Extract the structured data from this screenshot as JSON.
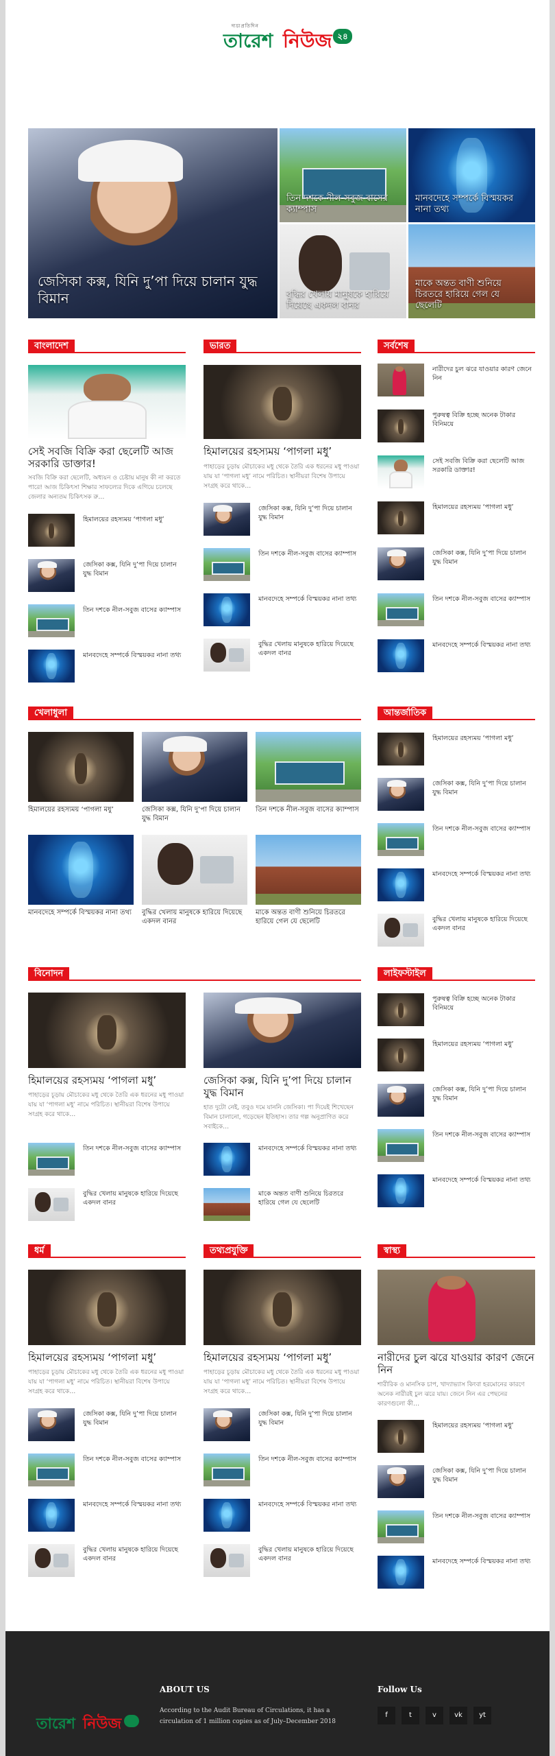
{
  "header": {
    "logo_tag": "দ্যচ্যপ্রতিদিন",
    "logo_word1": "তারেশ",
    "logo_word2": "নিউজ",
    "logo_badge": "২৪"
  },
  "hero": {
    "main": "জেসিকা কক্স, যিনি দু’পা দিয়ে চালান যুদ্ধ বিমান",
    "t1": "তিন দশকে নীল-সবুজ বাসের ক্যাম্পাস",
    "t2": "মানবদেহে সম্পর্কে বিস্ময়কর নানা তথ্য",
    "t3": "বুদ্ধির খেলায় মানুষকে হারিয়ে দিয়েছে একদল বানর",
    "t4": "মাকে অন্তত বাণী শুনিয়ে চিরতরে হারিয়ে গেল যে ছেলেটি"
  },
  "titles": {
    "cave": "হিমালয়ের রহস্যময় ‘পাগলা মধু’",
    "pilot": "জেসিকা কক্স, যিনি দু’পা দিয়ে চালান যুদ্ধ বিমান",
    "bus": "তিন দশকে নীল-সবুজ বাসের ক্যাম্পাস",
    "body": "মানবদেহে সম্পর্কে বিস্ময়কর নানা তথ্য",
    "chimp": "বুদ্ধির খেলায় মানুষকে হারিয়ে দিয়েছে একদল বানর",
    "ruin": "মাকে অন্তত বাণী শুনিয়ে চিরতরে হারিয়ে গেল যে ছেলেটি",
    "doctor": "সেই সবজি বিক্রি করা ছেলেটি আজ সরকারি ডাক্তার!",
    "woman": "নারীদের চুল ঝরে যাওয়ার কারণ জেনে নিন",
    "money": "পুরুষত্ব বিক্রি হচ্ছে অনেক টাকার বিনিময়ে"
  },
  "excerpts": {
    "doctor": "সবজি বিক্রি করা ছেলেটি, অধ্যয়ন ও চেষ্টায় মানুষ কী না করতে পারে! আজ চিকিৎসা শিক্ষার সাফল্যের দিকে এগিয়ে চলেছে জেলার অন্যতম চিকিৎসক রু…",
    "cave": "পাহাড়ের চূড়ায় মৌচাকের মধু থেকে তৈরি এক ধরনের মধু পাওয়া যায় যা ‘পাগলা মধু’ নামে পরিচিত। স্থানীয়রা বিশেষ উপায়ে সংগ্রহ করে থাকে…",
    "pilot": "হাত দুটো নেই, তবুও দমে যাননি জেসিকা। পা দিয়েই শিখেছেন বিমান চালানো, গড়েছেন ইতিহাস। তার গল্প অনুপ্রাণিত করে সবাইকে…",
    "woman": "শারীরিক ও মানসিক চাপ, খাদ্যাভ্যাস কিংবা হরমোনের কারণে অনেক নারীরই চুল ঝরে যায়। জেনে নিন এর পেছনের কারণগুলো কী…"
  },
  "sections": {
    "bangladesh": "বাংলাদেশ",
    "india": "ভারত",
    "latest": "সর্বশেষ",
    "sports": "খেলাধুলা",
    "international": "আন্তর্জাতিক",
    "entertainment": "বিনোদন",
    "lifestyle": "লাইফস্টাইল",
    "religion": "ধর্ম",
    "tech": "তথ্যপ্রযুক্তি",
    "health": "স্বাস্থ্য"
  },
  "footer": {
    "about_title": "ABOUT US",
    "about_text": "According to the Audit Bureau of Circulations, it has a circulation of 1 million copies as of July–December 2018",
    "follow_title": "Follow Us",
    "social": [
      "f",
      "t",
      "v",
      "vk",
      "yt"
    ]
  },
  "colors": {
    "accent": "#e4141b",
    "brand_green": "#0d8a4a",
    "footer_bg": "#252525"
  }
}
